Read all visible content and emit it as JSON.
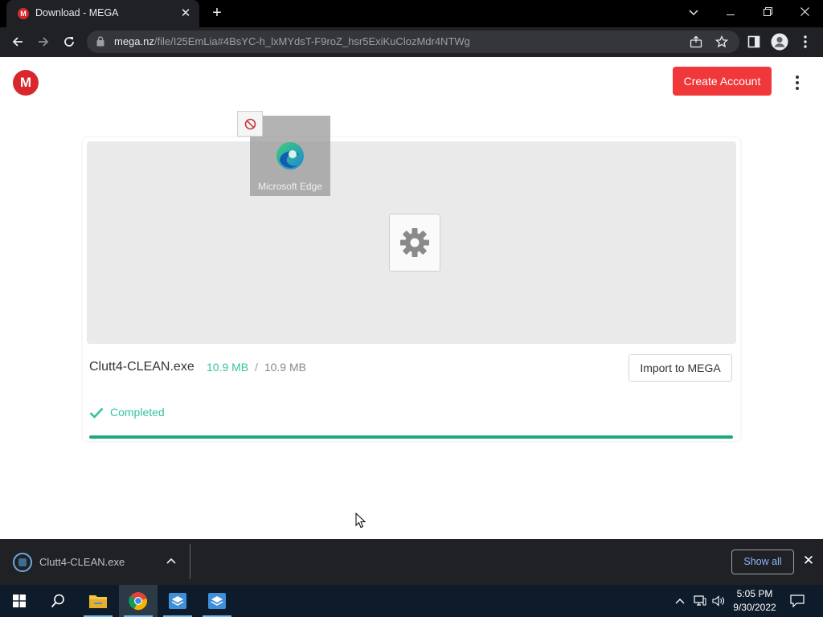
{
  "browser": {
    "tab_title": "Download - MEGA",
    "tab_favicon_letter": "M",
    "url_host": "mega.nz",
    "url_path": "/file/I25EmLia#4BsYC-h_lxMYdsT-F9roZ_hsr5ExiKuClozMdr4NTWg"
  },
  "page": {
    "logo_letter": "M",
    "create_account_label": "Create Account",
    "file": {
      "name": "Clutt4-CLEAN.exe",
      "downloaded": "10.9 MB",
      "separator": "/",
      "total": "10.9 MB",
      "status": "Completed",
      "progress": 1.0
    },
    "import_label": "Import to MEGA"
  },
  "drag_overlay": {
    "label": "Microsoft Edge"
  },
  "download_shelf": {
    "file_name": "Clutt4-CLEAN.exe",
    "show_all_label": "Show all"
  },
  "taskbar": {
    "time": "5:05 PM",
    "date": "9/30/2022"
  },
  "colors": {
    "mega_red": "#d9272e",
    "create_account_bg": "#f0373a",
    "completed_green": "#38c1a0",
    "progress_green": "#1ca97f"
  }
}
